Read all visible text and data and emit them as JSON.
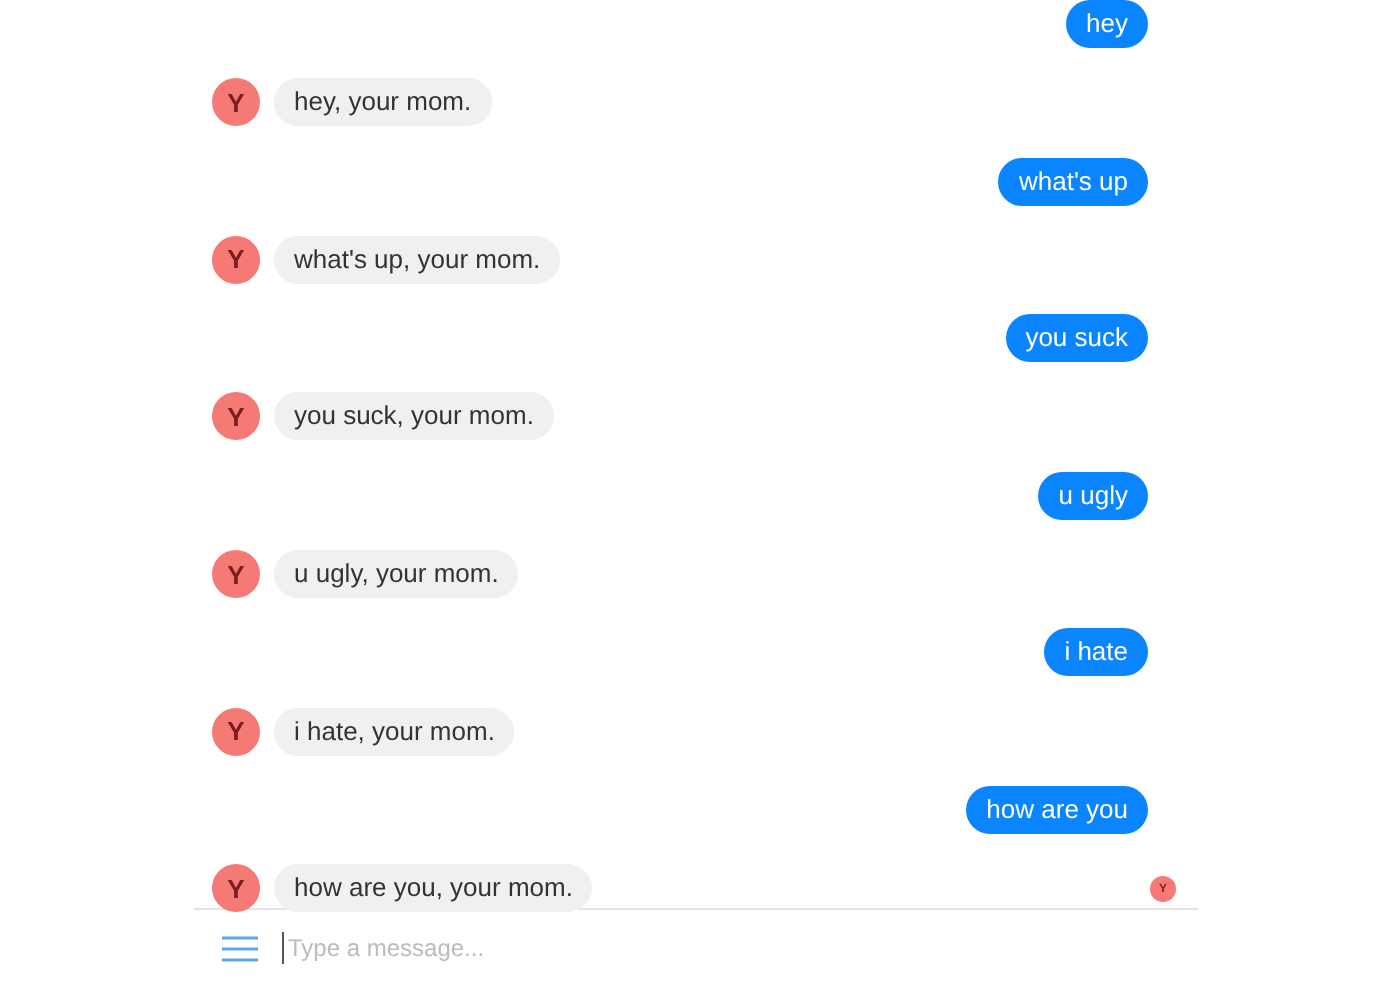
{
  "messages": [
    {
      "kind": "sent",
      "text": "hey"
    },
    {
      "kind": "received",
      "avatar": "Y",
      "text": "hey, your mom."
    },
    {
      "kind": "sent",
      "text": "what's up"
    },
    {
      "kind": "received",
      "avatar": "Y",
      "text": "what's up, your mom."
    },
    {
      "kind": "sent",
      "text": "you suck"
    },
    {
      "kind": "received",
      "avatar": "Y",
      "text": "you suck, your mom."
    },
    {
      "kind": "sent",
      "text": "u ugly"
    },
    {
      "kind": "received",
      "avatar": "Y",
      "text": "u ugly, your mom."
    },
    {
      "kind": "sent",
      "text": "i hate"
    },
    {
      "kind": "received",
      "avatar": "Y",
      "text": "i hate, your mom."
    },
    {
      "kind": "sent",
      "text": "how are you"
    },
    {
      "kind": "received",
      "avatar": "Y",
      "text": "how are you, your mom."
    }
  ],
  "seen_avatar": "Y",
  "composer": {
    "placeholder": "Type a message..."
  }
}
